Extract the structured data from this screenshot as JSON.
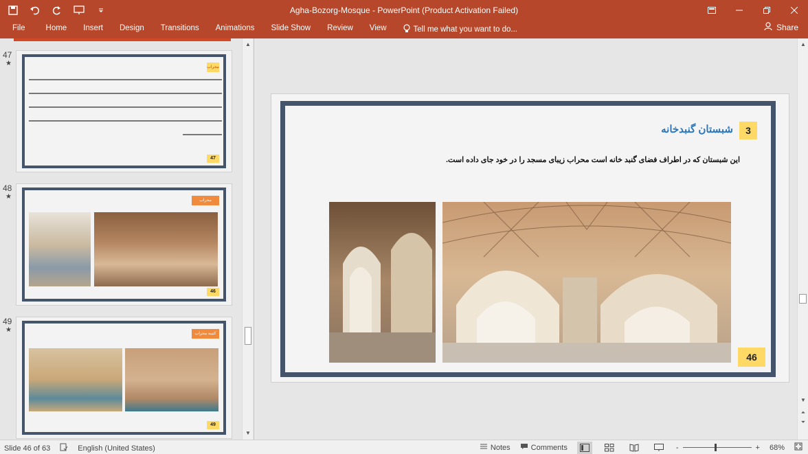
{
  "window": {
    "title": "Agha-Bozorg-Mosque - PowerPoint (Product Activation Failed)"
  },
  "qat": {
    "icons": [
      "save-icon",
      "undo-icon",
      "redo-icon",
      "present-icon",
      "customize-icon"
    ]
  },
  "ribbon": {
    "tabs": [
      "File",
      "Home",
      "Insert",
      "Design",
      "Transitions",
      "Animations",
      "Slide Show",
      "Review",
      "View"
    ],
    "tell_me": "Tell me what you want to do...",
    "share": "Share"
  },
  "thumbnails": [
    {
      "number": "47",
      "title": "محراب",
      "page": "47"
    },
    {
      "number": "48",
      "title": "محراب",
      "page": "46"
    },
    {
      "number": "49",
      "title": "کتیبه محراب",
      "page": "49"
    }
  ],
  "slide": {
    "number_box": "3",
    "title": "شبستان گنبدخانه",
    "body": "این شبستان که در اطراف فضای گنبد خانه است محراب زیبای مسجد را در خود جای داده است.",
    "page": "46"
  },
  "status": {
    "slide_info": "Slide 46 of 63",
    "language": "English (United States)",
    "notes": "Notes",
    "comments": "Comments",
    "zoom": "68%",
    "zoom_minus": "-",
    "zoom_plus": "+"
  },
  "colors": {
    "accent": "#b7472a",
    "frame": "#44546a",
    "highlight": "#ffd966",
    "title_blue": "#2e75b6"
  }
}
